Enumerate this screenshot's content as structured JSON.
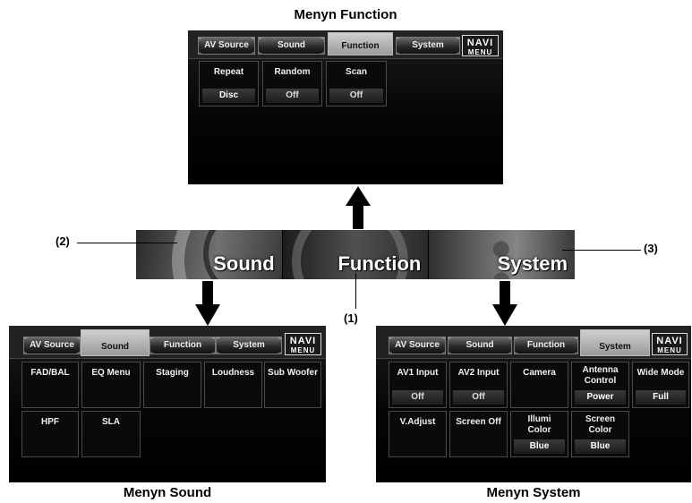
{
  "captions": {
    "top": "Menyn Function",
    "sound": "Menyn Sound",
    "system": "Menyn System"
  },
  "tabs": {
    "av_source": "AV Source",
    "sound": "Sound",
    "function": "Function",
    "system": "System",
    "navi_line1": "NAVI",
    "navi_line2": "MENU"
  },
  "function_menu": {
    "items": [
      {
        "label": "Repeat",
        "value": "Disc"
      },
      {
        "label": "Random",
        "value": "Off"
      },
      {
        "label": "Scan",
        "value": "Off"
      }
    ]
  },
  "banner": {
    "sound": "Sound",
    "function": "Function",
    "system": "System"
  },
  "callouts": {
    "one": "(1)",
    "two": "(2)",
    "three": "(3)"
  },
  "sound_menu": {
    "items": [
      {
        "label": "FAD/BAL"
      },
      {
        "label": "EQ Menu"
      },
      {
        "label": "Staging"
      },
      {
        "label": "Loudness"
      },
      {
        "label": "Sub Woofer"
      },
      {
        "label": "HPF"
      },
      {
        "label": "SLA"
      }
    ]
  },
  "system_menu": {
    "items": [
      {
        "label": "AV1 Input",
        "value": "Off"
      },
      {
        "label": "AV2 Input",
        "value": "Off"
      },
      {
        "label": "Camera"
      },
      {
        "label": "Antenna Control",
        "value": "Power"
      },
      {
        "label": "Wide Mode",
        "value": "Full"
      },
      {
        "label": "V.Adjust"
      },
      {
        "label": "Screen Off"
      },
      {
        "label": "Illumi Color",
        "value": "Blue"
      },
      {
        "label": "Screen Color",
        "value": "Blue"
      }
    ]
  },
  "colors": {
    "screen_bg": "#000000",
    "tab_active": "#b0b0b0",
    "arrow": "#000000"
  }
}
